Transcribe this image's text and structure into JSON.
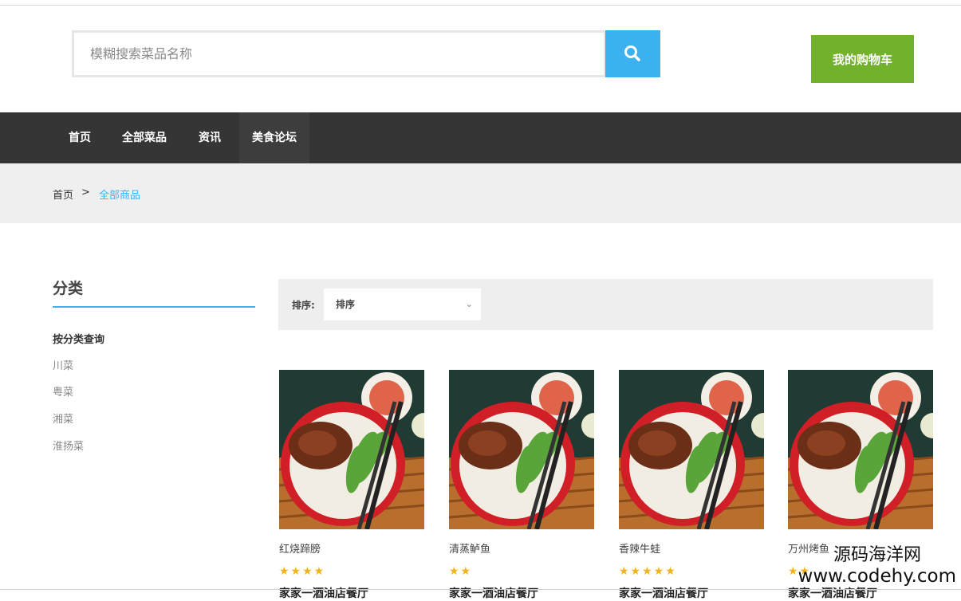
{
  "search": {
    "placeholder": "模糊搜索菜品名称",
    "icon": "search-icon"
  },
  "header": {
    "cart_label": "我的购物车",
    "brand_color": "#3cb1f0",
    "cart_color": "#72b12b"
  },
  "nav": {
    "items": [
      {
        "label": "首页"
      },
      {
        "label": "全部菜品"
      },
      {
        "label": "资讯"
      },
      {
        "label": "美食论坛"
      }
    ]
  },
  "breadcrumb": {
    "home": "首页",
    "separator": ">",
    "current": "全部商品"
  },
  "sidebar": {
    "title": "分类",
    "heading": "按分类查询",
    "items": [
      {
        "label": "川菜"
      },
      {
        "label": "粤菜"
      },
      {
        "label": "湘菜"
      },
      {
        "label": "淮扬菜"
      }
    ]
  },
  "sort": {
    "label": "排序:",
    "selected": "排序"
  },
  "products": [
    {
      "name": "红烧蹄膀",
      "rating": 4,
      "stars": "★★★★",
      "shop": "家家一酒油店餐厅"
    },
    {
      "name": "清蒸鲈鱼",
      "rating": 2,
      "stars": "★★",
      "shop": "家家一酒油店餐厅"
    },
    {
      "name": "香辣牛蛙",
      "rating": 5,
      "stars": "★★★★★",
      "shop": "家家一酒油店餐厅"
    },
    {
      "name": "万州烤鱼",
      "rating": 2,
      "stars": "★★",
      "shop": "家家一酒油店餐厅"
    }
  ],
  "watermark": {
    "line1": "源码海洋网",
    "line2": "www.codehy.com"
  }
}
